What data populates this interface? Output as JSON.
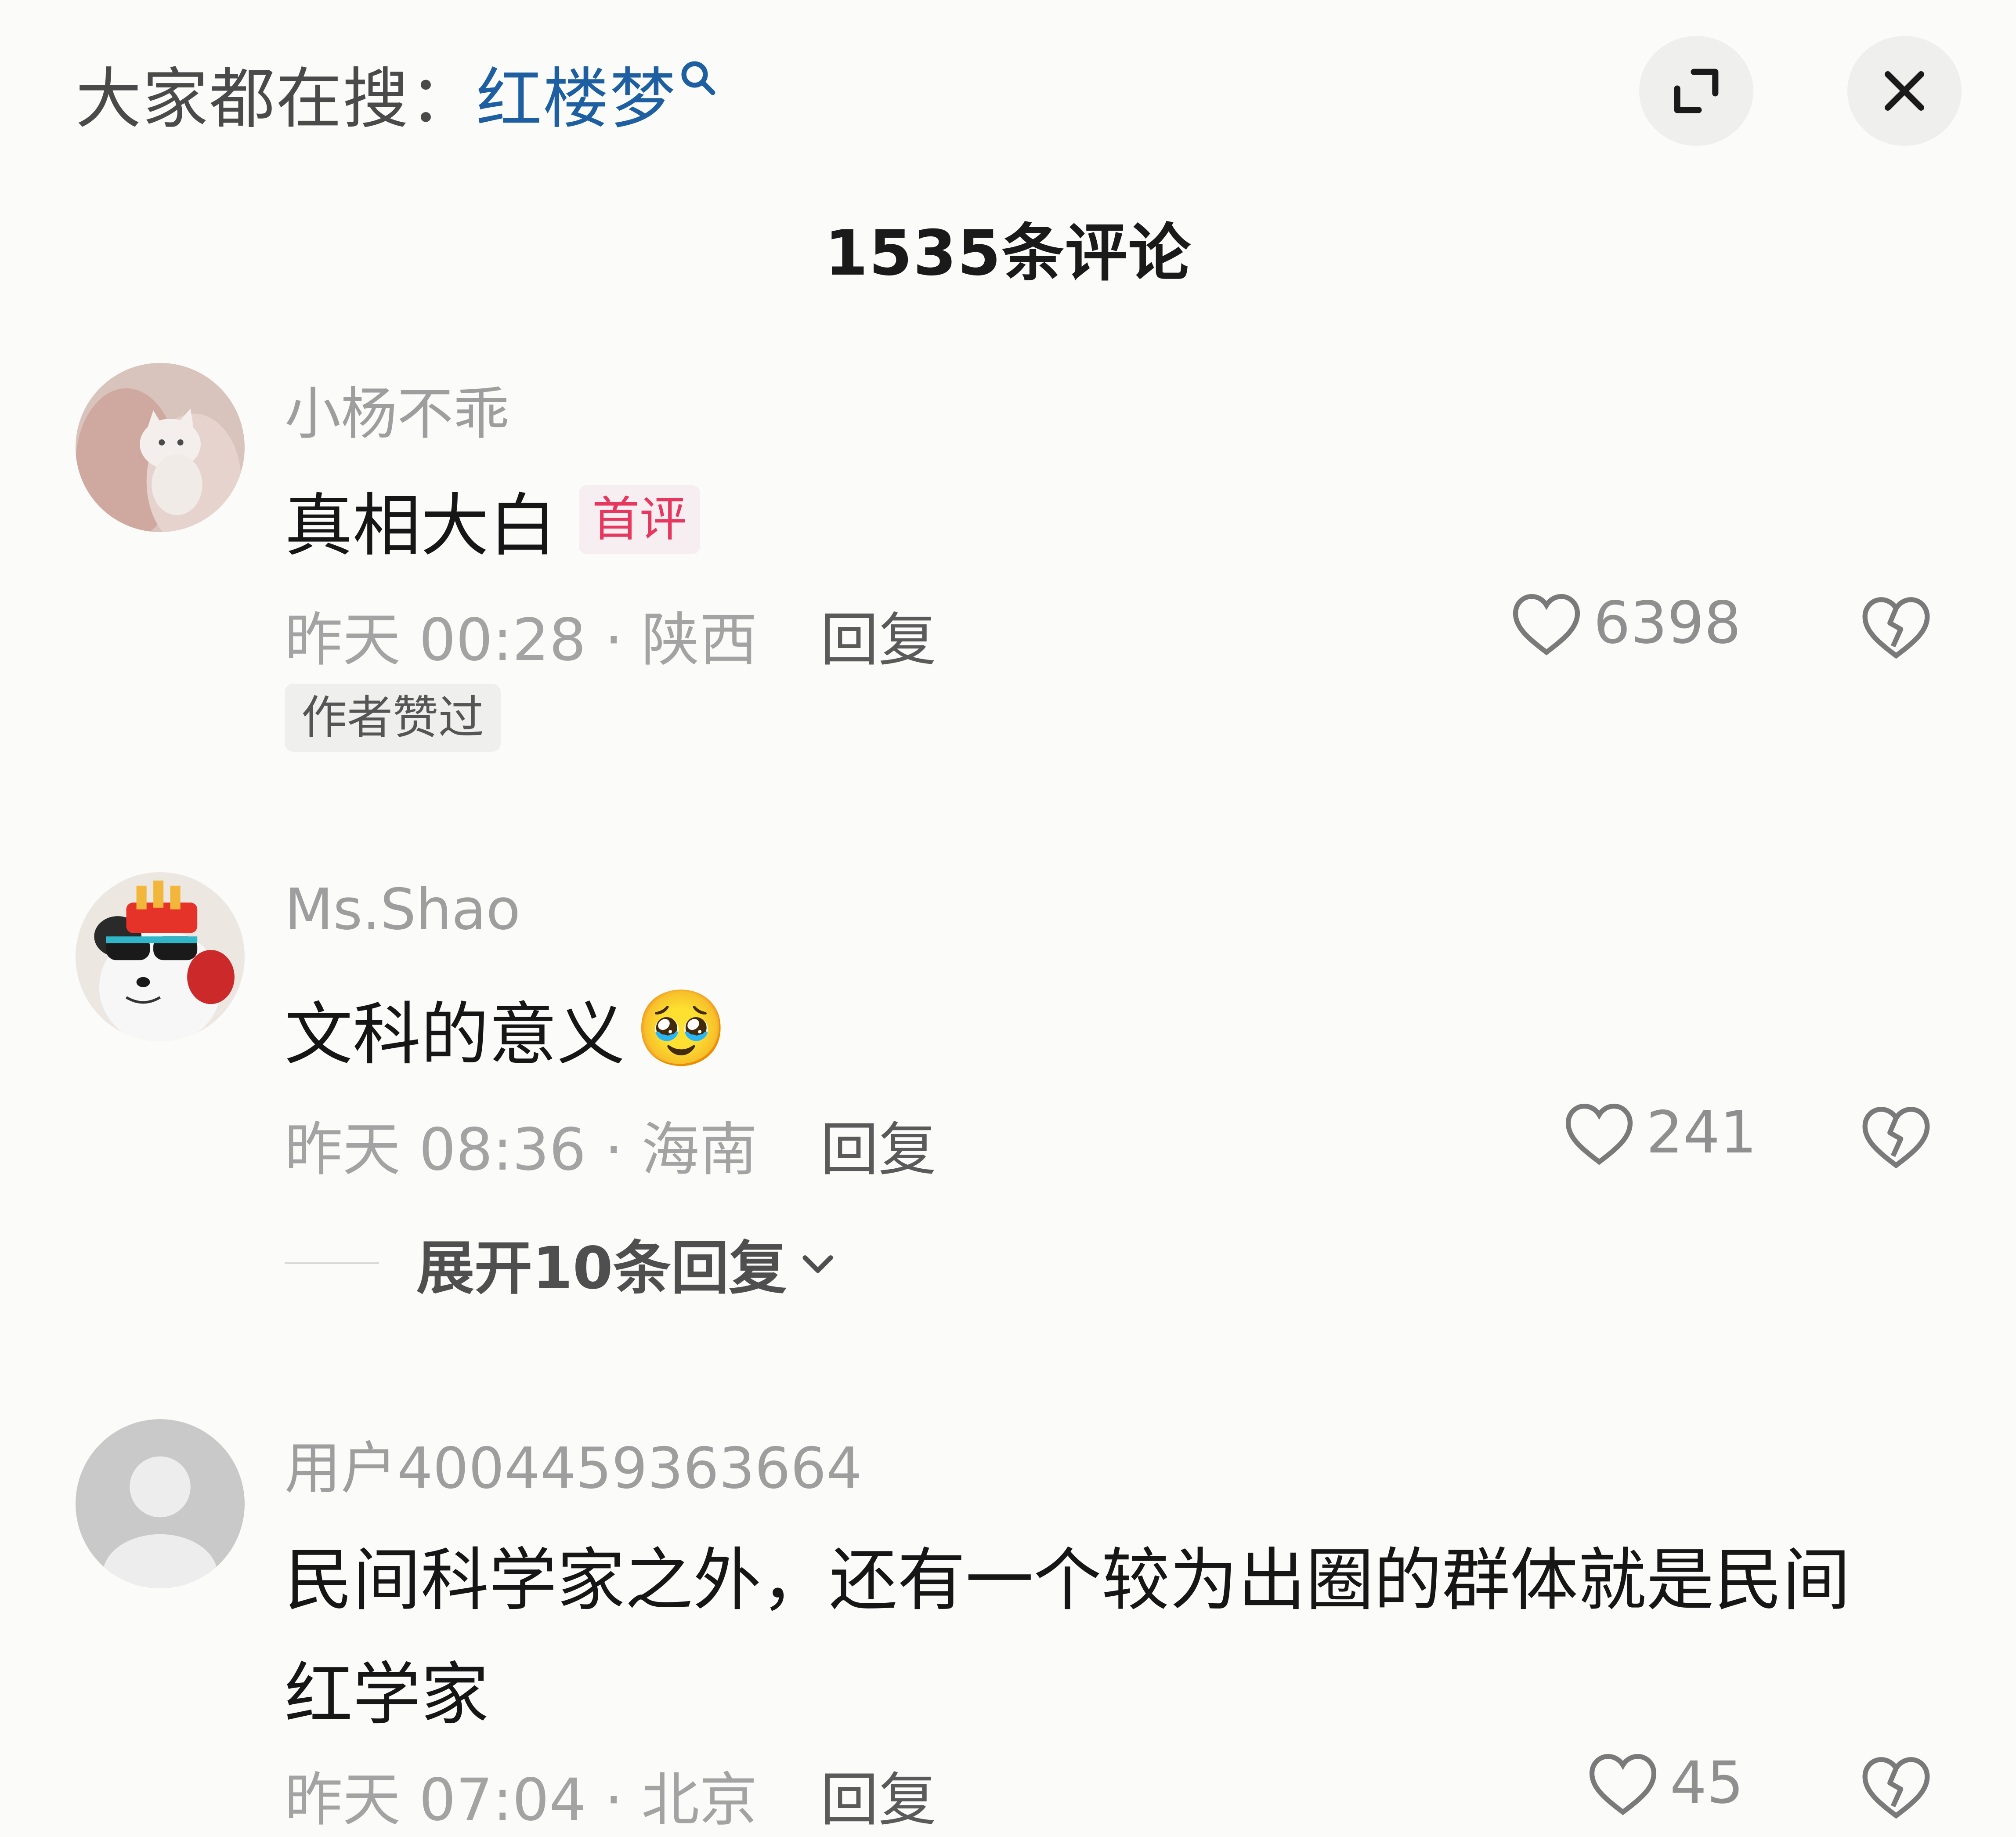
{
  "header": {
    "search_prefix": "大家都在搜：",
    "search_term": "红楼梦",
    "comment_count_label": "1535条评论"
  },
  "comments": [
    {
      "username": "小杨不乖",
      "text": "真相大白",
      "badge": "首评",
      "time_location": "昨天 00:28 · 陕西",
      "reply_label": "回复",
      "likes": "6398",
      "author_liked": "作者赞过"
    },
    {
      "username": "Ms.Shao",
      "text": "文科的意义",
      "emoji": "🥹",
      "time_location": "昨天 08:36 · 海南",
      "reply_label": "回复",
      "likes": "241",
      "expand_replies": "展开10条回复"
    },
    {
      "username": "用户4004459363664",
      "text_line1": "民间科学家之外，还有一个较为出圈的群体就是民间",
      "text_line2": "红学家",
      "time_location": "昨天 07:04 · 北京",
      "reply_label": "回复",
      "likes": "45"
    }
  ],
  "icons": {
    "search": "search-icon",
    "expand": "expand-icon",
    "close": "close-icon",
    "like": "heart-icon",
    "dislike": "broken-heart-icon",
    "chevron": "chevron-down-icon"
  },
  "colors": {
    "background": "#fbfbfa",
    "search_term": "#1d5fa0",
    "first_badge_text": "#e6385f",
    "muted_text": "#a3a3a3"
  }
}
